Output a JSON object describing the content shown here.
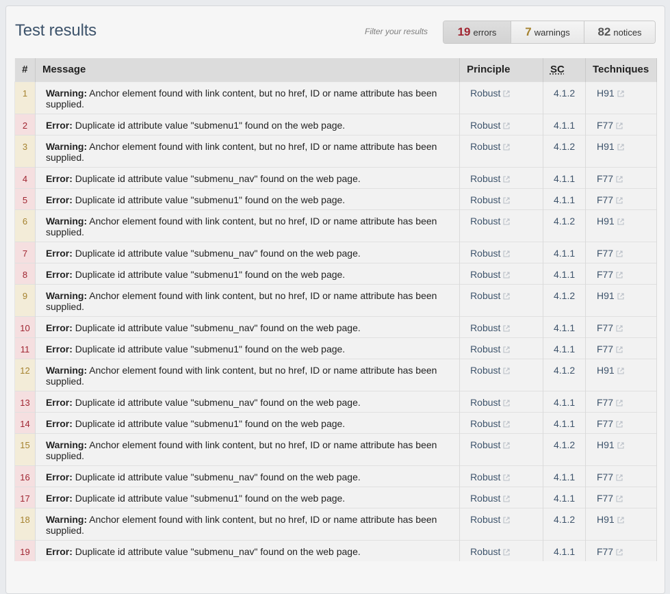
{
  "header": {
    "title": "Test results",
    "filter_label": "Filter your results",
    "filters": {
      "errors": {
        "count": "19",
        "label": "errors"
      },
      "warnings": {
        "count": "7",
        "label": "warnings"
      },
      "notices": {
        "count": "82",
        "label": "notices"
      }
    }
  },
  "table": {
    "columns": {
      "num": "#",
      "message": "Message",
      "principle": "Principle",
      "sc": "SC",
      "techniques": "Techniques"
    },
    "rows": [
      {
        "num": "1",
        "type": "warning",
        "label": "Warning:",
        "text": "Anchor element found with link content, but no href, ID or name attribute has been supplied.",
        "principle": "Robust",
        "sc": "4.1.2",
        "technique": "H91"
      },
      {
        "num": "2",
        "type": "error",
        "label": "Error:",
        "text": "Duplicate id attribute value \"submenu1\" found on the web page.",
        "principle": "Robust",
        "sc": "4.1.1",
        "technique": "F77"
      },
      {
        "num": "3",
        "type": "warning",
        "label": "Warning:",
        "text": "Anchor element found with link content, but no href, ID or name attribute has been supplied.",
        "principle": "Robust",
        "sc": "4.1.2",
        "technique": "H91"
      },
      {
        "num": "4",
        "type": "error",
        "label": "Error:",
        "text": "Duplicate id attribute value \"submenu_nav\" found on the web page.",
        "principle": "Robust",
        "sc": "4.1.1",
        "technique": "F77"
      },
      {
        "num": "5",
        "type": "error",
        "label": "Error:",
        "text": "Duplicate id attribute value \"submenu1\" found on the web page.",
        "principle": "Robust",
        "sc": "4.1.1",
        "technique": "F77"
      },
      {
        "num": "6",
        "type": "warning",
        "label": "Warning:",
        "text": "Anchor element found with link content, but no href, ID or name attribute has been supplied.",
        "principle": "Robust",
        "sc": "4.1.2",
        "technique": "H91"
      },
      {
        "num": "7",
        "type": "error",
        "label": "Error:",
        "text": "Duplicate id attribute value \"submenu_nav\" found on the web page.",
        "principle": "Robust",
        "sc": "4.1.1",
        "technique": "F77"
      },
      {
        "num": "8",
        "type": "error",
        "label": "Error:",
        "text": "Duplicate id attribute value \"submenu1\" found on the web page.",
        "principle": "Robust",
        "sc": "4.1.1",
        "technique": "F77"
      },
      {
        "num": "9",
        "type": "warning",
        "label": "Warning:",
        "text": "Anchor element found with link content, but no href, ID or name attribute has been supplied.",
        "principle": "Robust",
        "sc": "4.1.2",
        "technique": "H91"
      },
      {
        "num": "10",
        "type": "error",
        "label": "Error:",
        "text": "Duplicate id attribute value \"submenu_nav\" found on the web page.",
        "principle": "Robust",
        "sc": "4.1.1",
        "technique": "F77"
      },
      {
        "num": "11",
        "type": "error",
        "label": "Error:",
        "text": "Duplicate id attribute value \"submenu1\" found on the web page.",
        "principle": "Robust",
        "sc": "4.1.1",
        "technique": "F77"
      },
      {
        "num": "12",
        "type": "warning",
        "label": "Warning:",
        "text": "Anchor element found with link content, but no href, ID or name attribute has been supplied.",
        "principle": "Robust",
        "sc": "4.1.2",
        "technique": "H91"
      },
      {
        "num": "13",
        "type": "error",
        "label": "Error:",
        "text": "Duplicate id attribute value \"submenu_nav\" found on the web page.",
        "principle": "Robust",
        "sc": "4.1.1",
        "technique": "F77"
      },
      {
        "num": "14",
        "type": "error",
        "label": "Error:",
        "text": "Duplicate id attribute value \"submenu1\" found on the web page.",
        "principle": "Robust",
        "sc": "4.1.1",
        "technique": "F77"
      },
      {
        "num": "15",
        "type": "warning",
        "label": "Warning:",
        "text": "Anchor element found with link content, but no href, ID or name attribute has been supplied.",
        "principle": "Robust",
        "sc": "4.1.2",
        "technique": "H91"
      },
      {
        "num": "16",
        "type": "error",
        "label": "Error:",
        "text": "Duplicate id attribute value \"submenu_nav\" found on the web page.",
        "principle": "Robust",
        "sc": "4.1.1",
        "technique": "F77"
      },
      {
        "num": "17",
        "type": "error",
        "label": "Error:",
        "text": "Duplicate id attribute value \"submenu1\" found on the web page.",
        "principle": "Robust",
        "sc": "4.1.1",
        "technique": "F77"
      },
      {
        "num": "18",
        "type": "warning",
        "label": "Warning:",
        "text": "Anchor element found with link content, but no href, ID or name attribute has been supplied.",
        "principle": "Robust",
        "sc": "4.1.2",
        "technique": "H91"
      },
      {
        "num": "19",
        "type": "error",
        "label": "Error:",
        "text": "Duplicate id attribute value \"submenu_nav\" found on the web page.",
        "principle": "Robust",
        "sc": "4.1.1",
        "technique": "F77"
      }
    ]
  },
  "colors": {
    "error": "#a02531",
    "warning": "#a5822f",
    "link": "#3d536b"
  },
  "icons": {
    "external_link": "external-link-icon"
  }
}
